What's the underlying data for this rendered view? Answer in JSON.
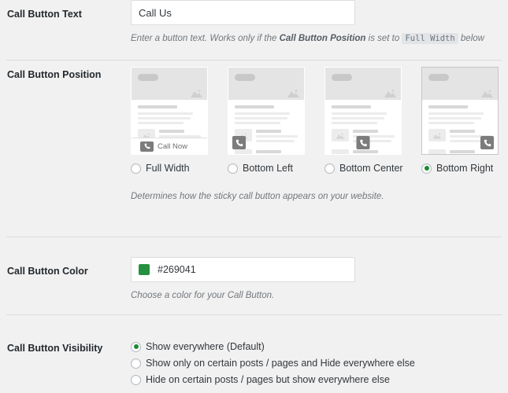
{
  "sections": {
    "call_button_text": {
      "label": "Call Button Text",
      "value": "Call Us",
      "placeholder": "",
      "help_prefix": "Enter a button text. Works only if the ",
      "help_bold": "Call Button Position",
      "help_mid": " is set to ",
      "help_code": "Full Width",
      "help_suffix": " below"
    },
    "call_button_position": {
      "label": "Call Button Position",
      "help": "Determines how the sticky call button appears on your website.",
      "options": [
        {
          "label": "Full Width",
          "selected": false,
          "preview": "full-width",
          "button_text": "Call Now"
        },
        {
          "label": "Bottom Left",
          "selected": false,
          "preview": "bottom-left"
        },
        {
          "label": "Bottom Center",
          "selected": false,
          "preview": "bottom-center"
        },
        {
          "label": "Bottom Right",
          "selected": true,
          "preview": "bottom-right"
        }
      ]
    },
    "call_button_color": {
      "label": "Call Button Color",
      "value": "#269041",
      "swatch_color": "#269041",
      "help": "Choose a color for your Call Button."
    },
    "call_button_visibility": {
      "label": "Call Button Visibility",
      "options": [
        {
          "label": "Show everywhere (Default)",
          "selected": true
        },
        {
          "label": "Show only on certain posts / pages and Hide everywhere else",
          "selected": false
        },
        {
          "label": "Hide on certain posts / pages but show everywhere else",
          "selected": false
        }
      ]
    }
  },
  "icons": {
    "phone": "phone-icon",
    "image_placeholder": "image-placeholder-icon"
  },
  "colors": {
    "accent_green": "#269041",
    "radio_green": "#1a8a32",
    "panel_bg": "#f1f1f1",
    "divider": "#dcdcdc"
  }
}
